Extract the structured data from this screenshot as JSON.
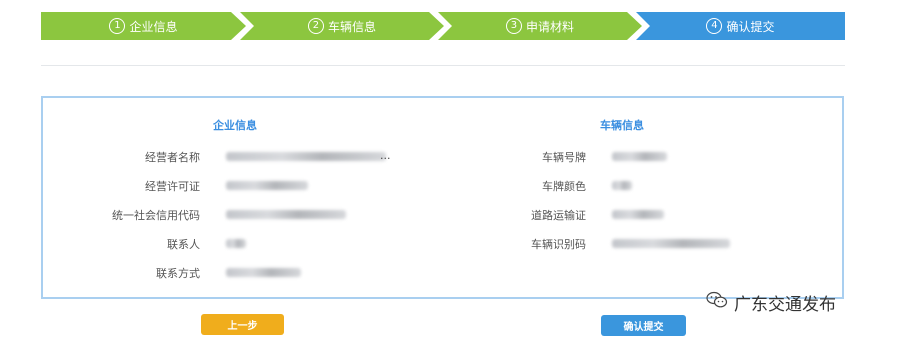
{
  "steps": [
    {
      "number": "1",
      "label": "企业信息",
      "state": "done"
    },
    {
      "number": "2",
      "label": "车辆信息",
      "state": "done"
    },
    {
      "number": "3",
      "label": "申请材料",
      "state": "done"
    },
    {
      "number": "4",
      "label": "确认提交",
      "state": "active"
    }
  ],
  "company_section": {
    "title": "企业信息",
    "fields": [
      {
        "label": "经营者名称",
        "value_suffix": "..."
      },
      {
        "label": "经营许可证"
      },
      {
        "label": "统一社会信用代码"
      },
      {
        "label": "联系人"
      },
      {
        "label": "联系方式"
      }
    ]
  },
  "vehicle_section": {
    "title": "车辆信息",
    "fields": [
      {
        "label": "车辆号牌"
      },
      {
        "label": "车牌颜色"
      },
      {
        "label": "道路运输证"
      },
      {
        "label": "车辆识别码"
      }
    ]
  },
  "buttons": {
    "prev": "上一步",
    "submit": "确认提交"
  },
  "watermark": {
    "text": "广东交通发布",
    "icon": "wechat-icon"
  },
  "colors": {
    "step_done": "#8cc63f",
    "step_active": "#3a96dd",
    "section_title": "#3a8ee0",
    "button_prev": "#f0ad1c",
    "button_submit": "#3a96dd",
    "panel_border": "#a9cff0"
  }
}
